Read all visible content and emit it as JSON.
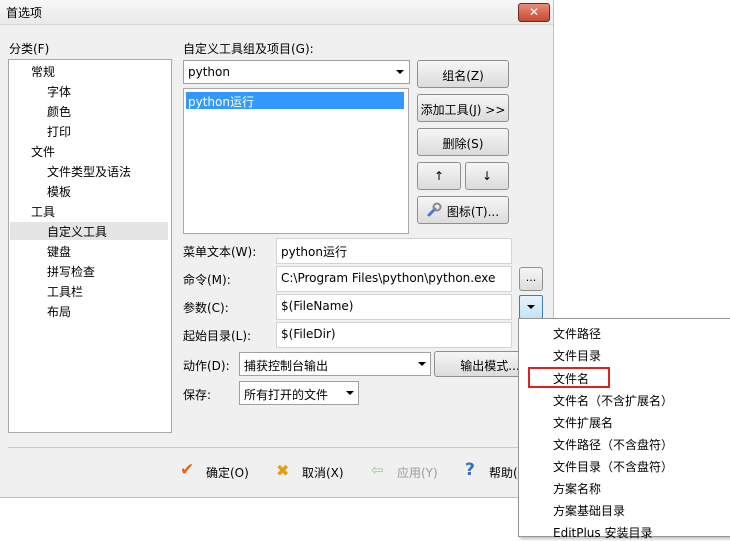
{
  "window": {
    "title": "首选项",
    "close_glyph": "✕"
  },
  "categories": {
    "label": "分类(F)",
    "items": [
      "常规",
      "字体",
      "颜色",
      "打印",
      "文件",
      "文件类型及语法",
      "模板",
      "工具",
      "自定义工具",
      "键盘",
      "拼写检查",
      "工具栏",
      "布局"
    ],
    "selected": "自定义工具"
  },
  "groups": {
    "label": "自定义工具组及项目(G):",
    "selected_group": "python",
    "items": [
      "python运行"
    ],
    "buttons": {
      "group_name": "组名(Z)",
      "add_tool": "添加工具(J) >>",
      "delete": "删除(S)",
      "up": "↑",
      "down": "↓",
      "icon": "图标(T)..."
    }
  },
  "form": {
    "menu_text_label": "菜单文本(W):",
    "menu_text_value": "python运行",
    "command_label": "命令(M):",
    "command_value": "C:\\Program Files\\python\\python.exe",
    "command_browse": "...",
    "args_label": "参数(C):",
    "args_value": "$(FileName)",
    "startdir_label": "起始目录(L):",
    "startdir_value": "$(FileDir)",
    "action_label": "动作(D):",
    "action_value": "捕获控制台输出",
    "output_mode": "输出模式...",
    "save_label": "保存:",
    "save_value": "所有打开的文件"
  },
  "footer": {
    "ok": "确定(O)",
    "cancel": "取消(X)",
    "apply": "应用(Y)",
    "help": "帮助("
  },
  "popup_menu": {
    "items": [
      "文件路径",
      "文件目录",
      "文件名",
      "文件名（不含扩展名）",
      "文件扩展名",
      "文件路径（不含盘符）",
      "文件目录（不含盘符）",
      "方案名称",
      "方案基础目录",
      "EditPlus 安装目录"
    ],
    "highlighted": "文件名"
  },
  "colors": {
    "selection": "#3399ff",
    "highlight_box": "#e12020"
  }
}
